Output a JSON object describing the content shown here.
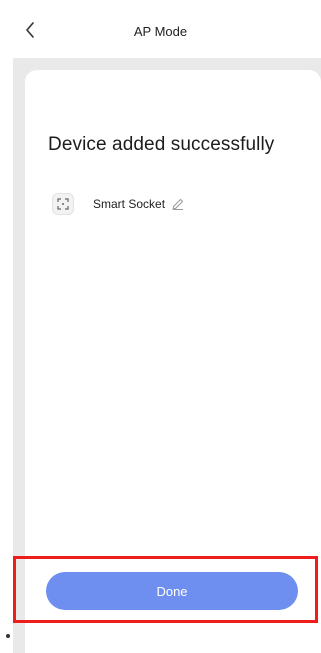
{
  "nav": {
    "title": "AP Mode",
    "back_icon": "chevron-left-icon"
  },
  "content": {
    "headline": "Device added successfully",
    "device": {
      "name": "Smart Socket",
      "icon": "smart-socket-icon",
      "edit_icon": "pencil-icon"
    }
  },
  "footer": {
    "done_label": "Done"
  },
  "colors": {
    "accent": "#6e8ff0",
    "highlight": "#ee1c1c",
    "background": "#e9e9ea"
  }
}
